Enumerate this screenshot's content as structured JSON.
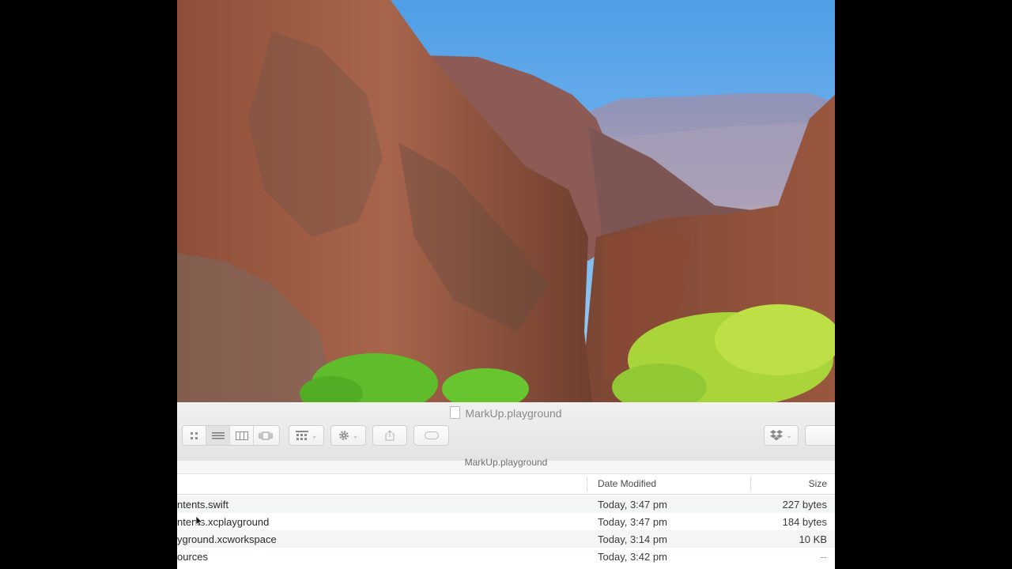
{
  "window": {
    "title": "MarkUp.playground",
    "path_label": "MarkUp.playground"
  },
  "toolbar": {
    "view_icons": [
      "icon-view-icon",
      "list-view-icon",
      "column-view-icon",
      "cover-flow-icon"
    ],
    "arrange_icon": "arrange-grid-icon",
    "action_icon": "gear-icon",
    "share_icon": "share-icon",
    "tag_icon": "tag-icon",
    "dropbox_icon": "dropbox-icon"
  },
  "columns": {
    "date_modified": "Date Modified",
    "size": "Size"
  },
  "files": [
    {
      "name": "ntents.swift",
      "date": "Today, 3:47 pm",
      "size": "227 bytes"
    },
    {
      "name": "ntents.xcplayground",
      "date": "Today, 3:47 pm",
      "size": "184 bytes"
    },
    {
      "name": "yground.xcworkspace",
      "date": "Today, 3:14 pm",
      "size": "10 KB"
    },
    {
      "name": "ources",
      "date": "Today, 3:42 pm",
      "size": "--"
    }
  ],
  "colors": {
    "sky": "#5aa8ea",
    "rock": "#a5614a",
    "foliage": "#8bd23a"
  }
}
